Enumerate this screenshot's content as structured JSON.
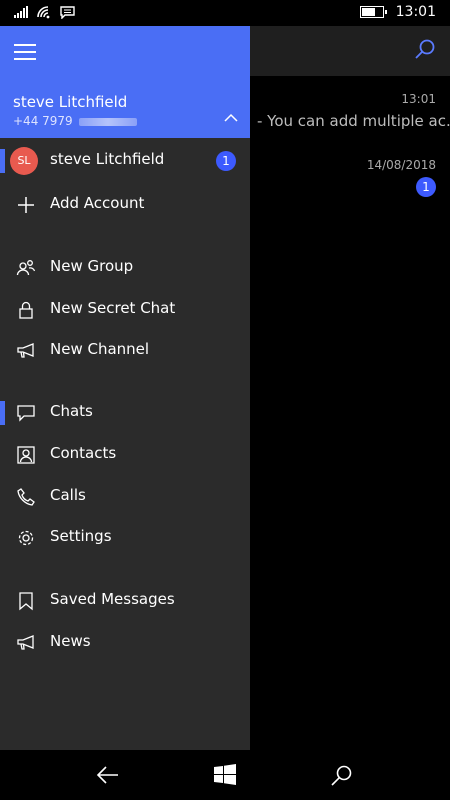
{
  "status_bar": {
    "time": "13:01",
    "icons": [
      "signal-icon",
      "wifi-icon",
      "message-icon",
      "battery-icon"
    ]
  },
  "background_chats": {
    "rows": [
      {
        "time": "13:01",
        "preview": "- You can add multiple ac..."
      },
      {
        "time": "14/08/2018",
        "badge": "1"
      }
    ]
  },
  "drawer": {
    "header": {
      "user_name": "steve Litchfield",
      "phone_prefix": "+44 7979",
      "color": "#4a6ef5"
    },
    "accounts": [
      {
        "initials": "SL",
        "name": "steve Litchfield",
        "badge": "1",
        "avatar_color": "#e85a4f"
      }
    ],
    "add_account_label": "Add Account",
    "create_items": [
      {
        "label": "New Group",
        "icon": "group-icon"
      },
      {
        "label": "New Secret Chat",
        "icon": "lock-icon"
      },
      {
        "label": "New Channel",
        "icon": "megaphone-icon"
      }
    ],
    "nav_items": [
      {
        "label": "Chats",
        "icon": "chat-bubble-icon",
        "selected": true
      },
      {
        "label": "Contacts",
        "icon": "contact-card-icon"
      },
      {
        "label": "Calls",
        "icon": "phone-icon"
      },
      {
        "label": "Settings",
        "icon": "gear-icon"
      }
    ],
    "extra_items": [
      {
        "label": "Saved Messages",
        "icon": "bookmark-icon"
      },
      {
        "label": "News",
        "icon": "megaphone-icon"
      }
    ]
  },
  "nav_bar": {
    "buttons": [
      "back-arrow-icon",
      "windows-start-icon",
      "search-icon"
    ]
  }
}
